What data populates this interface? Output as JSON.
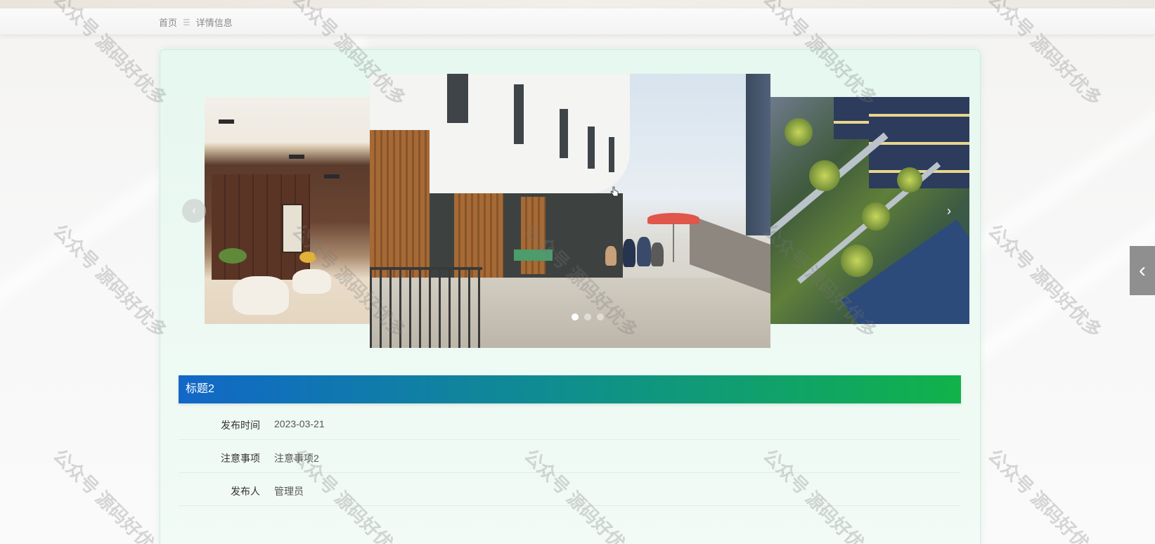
{
  "breadcrumb": {
    "home": "首页",
    "separator": "☰",
    "current": "详情信息"
  },
  "carousel": {
    "slides": [
      "lobby-interior",
      "rooftop-terrace",
      "courtyard-aerial"
    ],
    "active_index": 0,
    "dot_count": 3,
    "prev_icon": "chevron-left-icon",
    "next_icon": "chevron-right-icon"
  },
  "detail": {
    "title": "标题2",
    "rows": [
      {
        "label": "发布时间",
        "value": "2023-03-21"
      },
      {
        "label": "注意事项",
        "value": "注意事项2"
      },
      {
        "label": "发布人",
        "value": "管理员"
      }
    ]
  },
  "side_tab": {
    "icon": "chevron-left-icon"
  },
  "watermark": "公众号 源码好优多",
  "colors": {
    "title_gradient_start": "#1167c8",
    "title_gradient_end": "#11b24a",
    "card_bg": "#e6f8ef"
  }
}
